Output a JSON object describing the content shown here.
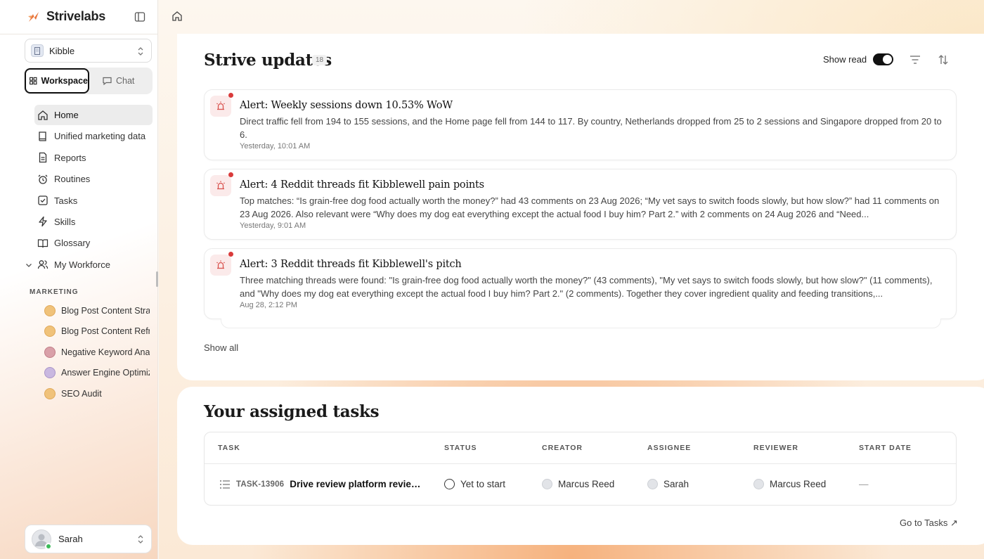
{
  "brand": {
    "name": "Strivelabs",
    "accent": "#e8743a"
  },
  "workspace_select": {
    "value": "Kibble"
  },
  "mode_tabs": [
    {
      "label": "Workspace",
      "active": true,
      "icon": "grid-icon"
    },
    {
      "label": "Chat",
      "active": false,
      "icon": "chat-icon"
    }
  ],
  "nav": {
    "items": [
      {
        "label": "Home",
        "icon": "home-icon",
        "active": true
      },
      {
        "label": "Unified marketing data",
        "icon": "book-icon"
      },
      {
        "label": "Reports",
        "icon": "document-icon"
      },
      {
        "label": "Routines",
        "icon": "alarm-clock-icon"
      },
      {
        "label": "Tasks",
        "icon": "checkbox-icon"
      },
      {
        "label": "Skills",
        "icon": "lightning-icon"
      },
      {
        "label": "Glossary",
        "icon": "open-book-icon"
      },
      {
        "label": "My Workforce",
        "icon": "users-icon"
      }
    ]
  },
  "marketing": {
    "label": "MARKETING",
    "agents": [
      {
        "label": "Blog Post Content Strategy",
        "avatar_color": "#f0c27a"
      },
      {
        "label": "Blog Post Content Refresh",
        "avatar_color": "#f0c27a"
      },
      {
        "label": "Negative Keyword Analysis",
        "avatar_color": "#d9a0a8"
      },
      {
        "label": "Answer Engine Optimization",
        "avatar_color": "#c9b8e0"
      },
      {
        "label": "SEO Audit",
        "avatar_color": "#f0c27a"
      }
    ]
  },
  "user": {
    "name": "Sarah",
    "status_color": "#3dbb5a"
  },
  "updates": {
    "title": "Strive updates",
    "count": "18",
    "show_read_label": "Show read",
    "show_read_on": true,
    "show_all_label": "Show all",
    "alerts": [
      {
        "title": "Alert: Weekly sessions down 10.53% WoW",
        "body": "Direct traffic fell from 194 to 155 sessions, and the Home page fell from 144 to 117. By country, Netherlands dropped from 25 to 2 sessions and Singapore dropped from 20 to 6.",
        "time": "Yesterday, 10:01 AM",
        "unread": true
      },
      {
        "title": "Alert: 4 Reddit threads fit Kibblewell pain points",
        "body": "Top matches: “Is grain-free dog food actually worth the money?” had 43 comments on 23 Aug 2026; “My vet says to switch foods slowly, but how slow?” had 11 comments on 23 Aug 2026. Also relevant were “Why does my dog eat everything except the actual food I buy him? Part 2.” with 2 comments on 24 Aug 2026 and “Need...",
        "time": "Yesterday, 9:01 AM",
        "unread": true
      },
      {
        "title": "Alert: 3 Reddit threads fit Kibblewell's pitch",
        "body": "Three matching threads were found: \"Is grain-free dog food actually worth the money?\" (43 comments), \"My vet says to switch foods slowly, but how slow?\" (11 comments), and \"Why does my dog eat everything except the actual food I buy him? Part 2.\" (2 comments). Together they cover ingredient quality and feeding transitions,...",
        "time": "Aug 28, 2:12 PM",
        "unread": true
      }
    ]
  },
  "tasks": {
    "title": "Your assigned tasks",
    "columns": [
      "TASK",
      "STATUS",
      "CREATOR",
      "ASSIGNEE",
      "REVIEWER",
      "START DATE"
    ],
    "rows": [
      {
        "id": "TASK-13906",
        "name": "Drive review platform reviews",
        "status": "Yet to start",
        "creator": "Marcus Reed",
        "assignee": "Sarah",
        "reviewer": "Marcus Reed",
        "start_date": "—"
      }
    ],
    "go_to_label": "Go to Tasks ↗"
  }
}
